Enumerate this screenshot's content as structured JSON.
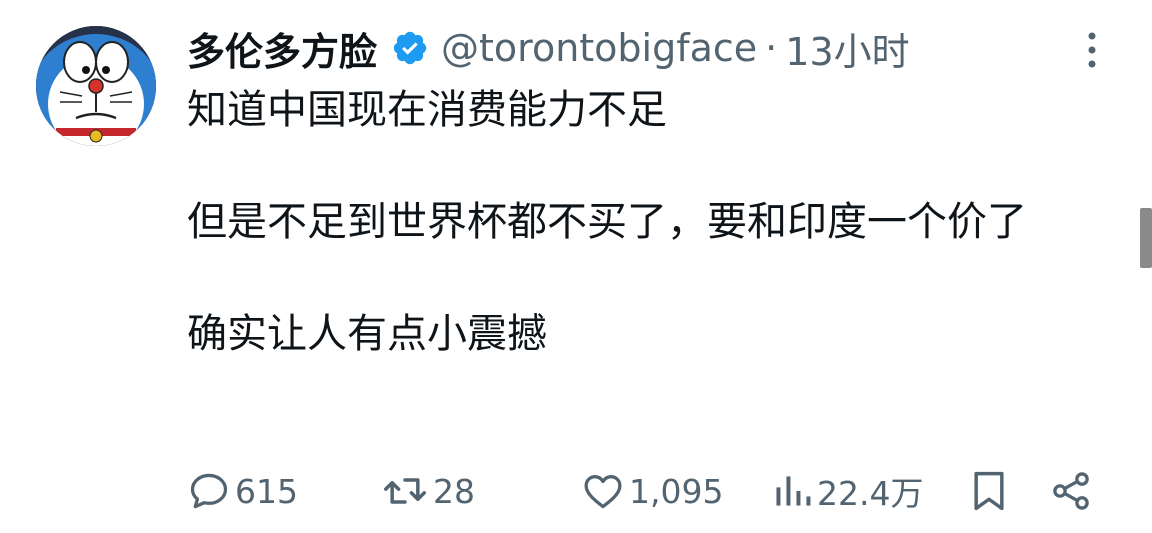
{
  "tweet": {
    "display_name": "多伦多方脸",
    "verified": true,
    "handle": "@torontobigface",
    "separator": "·",
    "time": "13小时",
    "paragraphs": [
      "知道中国现在消费能力不足",
      "但是不足到世界杯都不买了，要和印度一个价了",
      "确实让人有点小震撼"
    ]
  },
  "actions": {
    "reply_count": "615",
    "retweet_count": "28",
    "like_count": "1,095",
    "views_count": "22.4万"
  },
  "icons": {
    "avatar": "doraemon-avatar",
    "verified": "verified-badge-icon",
    "more": "more-vertical-icon",
    "reply": "reply-icon",
    "retweet": "retweet-icon",
    "like": "heart-icon",
    "views": "views-chart-icon",
    "bookmark": "bookmark-icon",
    "share": "share-icon"
  },
  "colors": {
    "text": "#0f1419",
    "secondary": "#536471",
    "verified": "#1d9bf0"
  }
}
